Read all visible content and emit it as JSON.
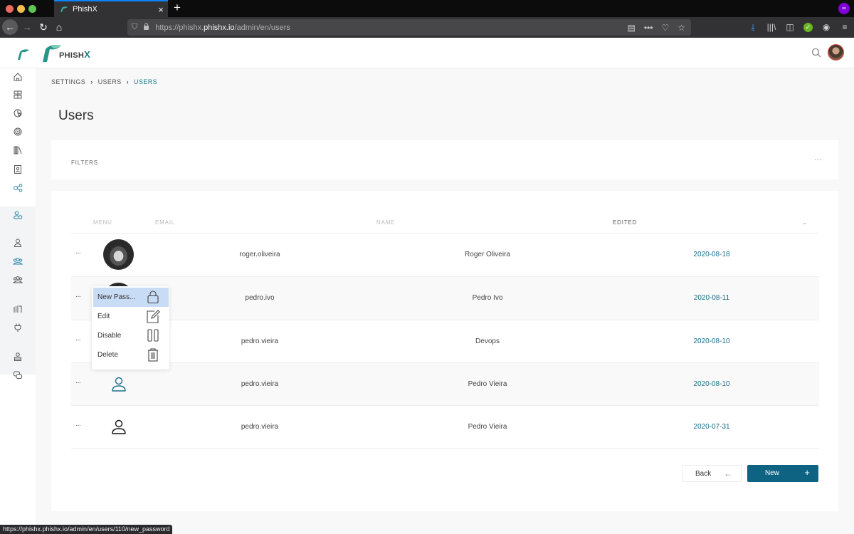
{
  "browser": {
    "tab_title": "PhishX",
    "tab_close": "×",
    "new_tab": "+",
    "url_prefix": "https://phishx.",
    "url_domain": "phishx.io",
    "url_path": "/admin/en/users",
    "status_url": "https://phishx.phishx.io/admin/en/users/110/new_password",
    "icons": {
      "back": "←",
      "forward": "→",
      "reload": "↻",
      "home": "⌂",
      "shield": "⛉",
      "lock": "🔒",
      "reader": "▤",
      "more": "•••",
      "pocket": "♡",
      "star": "☆",
      "download": "⤓",
      "library": "|||\\",
      "sidebar": "◫",
      "sync_check": "✓",
      "account": "◉",
      "menu": "≡",
      "private": "∞"
    }
  },
  "app": {
    "logo_text": "PHISH",
    "logo_x": "X",
    "brand_color": "#1f7a7a",
    "accent_color": "#0e6382"
  },
  "breadcrumb": [
    "SETTINGS",
    "USERS",
    "USERS"
  ],
  "breadcrumb_sep": "›",
  "page_title": "Users",
  "filters": {
    "label": "FILTERS",
    "more": "···"
  },
  "table": {
    "columns": [
      "MENU",
      "EMAIL",
      "NAME",
      "EDITED"
    ],
    "sort_icon": "⌄",
    "row_menu": "···",
    "rows": [
      {
        "email": "roger.oliveira",
        "name": "Roger Oliveira",
        "edited": "2020-08-18",
        "avatar": "photo"
      },
      {
        "email": "pedro.ivo",
        "name": "Pedro Ivo",
        "edited": "2020-08-11",
        "avatar": "photo"
      },
      {
        "email": "pedro.vieira",
        "name": "Devops",
        "edited": "2020-08-10",
        "avatar": "none"
      },
      {
        "email": "pedro.vieira",
        "name": "Pedro Vieira",
        "edited": "2020-08-10",
        "avatar": "user-icon-teal"
      },
      {
        "email": "pedro.vieira",
        "name": "Pedro Vieira",
        "edited": "2020-07-31",
        "avatar": "user-icon-black"
      }
    ]
  },
  "context_menu": {
    "items": [
      {
        "label": "New Pass...",
        "icon": "lock-icon",
        "active": true
      },
      {
        "label": "Edit",
        "icon": "edit-icon",
        "active": false
      },
      {
        "label": "Disable",
        "icon": "pause-icon",
        "active": false
      },
      {
        "label": "Delete",
        "icon": "trash-icon",
        "active": false
      }
    ]
  },
  "actions": {
    "back_label": "Back",
    "back_icon": "←",
    "new_label": "New",
    "new_icon": "+"
  }
}
